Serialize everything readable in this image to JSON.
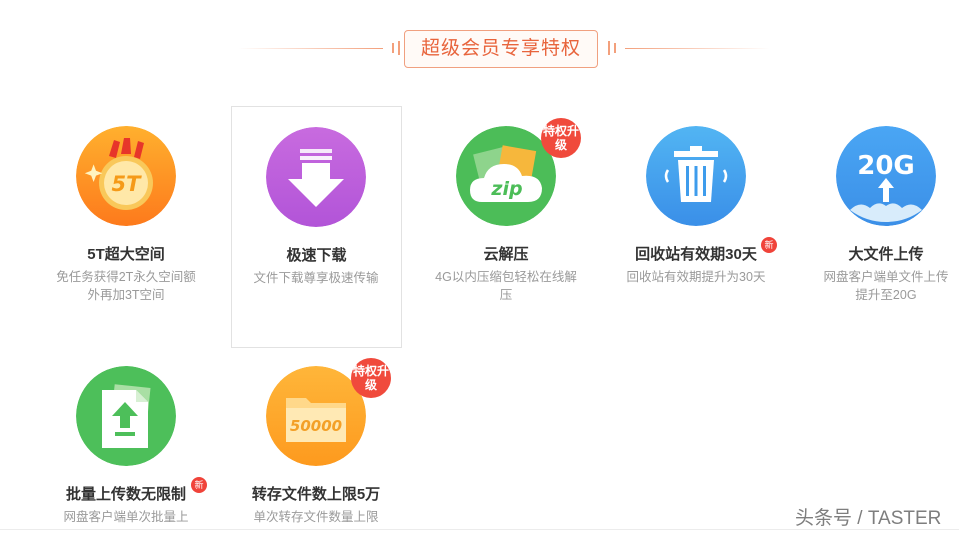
{
  "header": {
    "title": "超级会员专享特权"
  },
  "cards": [
    {
      "name": "5T超大空间",
      "desc": "免任务获得2T永久空间额外再加3T空间",
      "icon_text": "5T"
    },
    {
      "name": "极速下载",
      "desc": "文件下载尊享极速传输"
    },
    {
      "name": "云解压",
      "desc": "4G以内压缩包轻松在线解压",
      "icon_text": "zip",
      "badge": "特权升级"
    },
    {
      "name": "回收站有效期30天",
      "desc": "回收站有效期提升为30天",
      "badge_new": "新"
    },
    {
      "name": "大文件上传",
      "desc": "网盘客户端单文件上传提升至20G",
      "icon_text": "20G"
    },
    {
      "name": "批量上传数无限制",
      "desc": "网盘客户端单次批量上",
      "badge_new": "新"
    },
    {
      "name": "转存文件数上限5万",
      "desc": "单次转存文件数量上限",
      "icon_text": "50000",
      "badge": "特权升级"
    }
  ],
  "watermark": "头条号 / TASTER",
  "colors": {
    "accent": "#e8643c",
    "badge": "#f04a3c"
  }
}
